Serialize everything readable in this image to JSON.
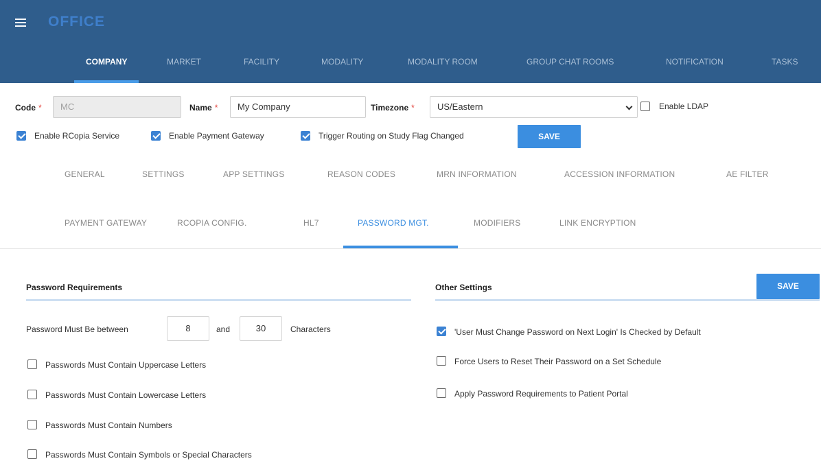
{
  "app": {
    "title": "OFFICE"
  },
  "main_tabs": [
    {
      "label": "COMPANY"
    },
    {
      "label": "MARKET"
    },
    {
      "label": "FACILITY"
    },
    {
      "label": "MODALITY"
    },
    {
      "label": "MODALITY ROOM"
    },
    {
      "label": "GROUP CHAT ROOMS"
    },
    {
      "label": "NOTIFICATION"
    },
    {
      "label": "TASKS"
    }
  ],
  "company": {
    "code_label": "Code",
    "code_value": "MC",
    "name_label": "Name",
    "name_value": "My Company",
    "timezone_label": "Timezone",
    "timezone_value": "US/Eastern",
    "required_mark": "*",
    "enable_ldap": {
      "label": "Enable LDAP",
      "checked": false
    },
    "enable_rcopia": {
      "label": "Enable RCopia Service",
      "checked": true
    },
    "enable_payment": {
      "label": "Enable Payment Gateway",
      "checked": true
    },
    "trigger_routing": {
      "label": "Trigger Routing on Study Flag Changed",
      "checked": true
    },
    "save_label": "SAVE"
  },
  "sub_tabs_row1": [
    {
      "label": "GENERAL"
    },
    {
      "label": "SETTINGS"
    },
    {
      "label": "APP SETTINGS"
    },
    {
      "label": "REASON CODES"
    },
    {
      "label": "MRN INFORMATION"
    },
    {
      "label": "ACCESSION INFORMATION"
    },
    {
      "label": "AE FILTER"
    }
  ],
  "sub_tabs_row2": [
    {
      "label": "PAYMENT GATEWAY"
    },
    {
      "label": "RCOPIA CONFIG."
    },
    {
      "label": "HL7"
    },
    {
      "label": "PASSWORD MGT."
    },
    {
      "label": "MODIFIERS"
    },
    {
      "label": "LINK ENCRYPTION"
    }
  ],
  "password_requirements": {
    "title": "Password Requirements",
    "length_prefix": "Password Must Be between",
    "length_min": "8",
    "length_and": "and",
    "length_max": "30",
    "length_suffix": "Characters",
    "options": [
      {
        "label": "Passwords Must Contain Uppercase Letters",
        "checked": false
      },
      {
        "label": "Passwords Must Contain Lowercase Letters",
        "checked": false
      },
      {
        "label": "Passwords Must Contain Numbers",
        "checked": false
      },
      {
        "label": "Passwords Must Contain Symbols or Special Characters",
        "checked": false
      }
    ]
  },
  "other_settings": {
    "title": "Other Settings",
    "save_label": "SAVE",
    "options": [
      {
        "label": "'User Must Change Password on Next Login' Is Checked by Default",
        "checked": true
      },
      {
        "label": "Force Users to Reset Their Password on a Set Schedule",
        "checked": false
      },
      {
        "label": "Apply Password Requirements to Patient Portal",
        "checked": false
      }
    ]
  },
  "colors": {
    "header_bg": "#2f5d8c",
    "accent": "#3b8ee0",
    "checkbox_on": "#3b82d3"
  }
}
